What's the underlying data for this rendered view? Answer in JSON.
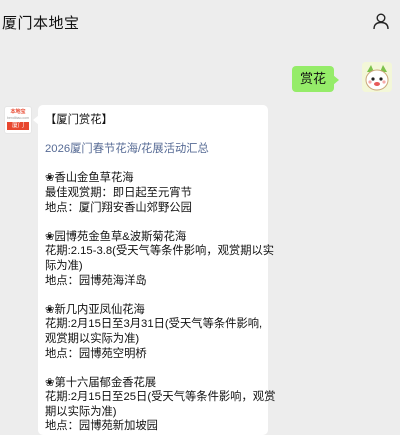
{
  "header": {
    "title": "厦门本地宝",
    "user_icon": "person-icon"
  },
  "chat": {
    "user_message": "赏花",
    "bot_avatar": {
      "line1": "本地宝",
      "line2": "bendibao.com",
      "badge": "厦门"
    },
    "bot_lines": [
      {
        "text": "【厦门赏花】",
        "link": false
      },
      {
        "text": "",
        "link": false
      },
      {
        "text": "2026厦门春节花海/花展活动汇总",
        "link": true
      },
      {
        "text": "",
        "link": false
      },
      {
        "text": "❀香山金鱼草花海",
        "link": false
      },
      {
        "text": "最佳观赏期：即日起至元宵节",
        "link": false
      },
      {
        "text": "地点：厦门翔安香山郊野公园",
        "link": false
      },
      {
        "text": "",
        "link": false
      },
      {
        "text": "❀园博苑金鱼草&波斯菊花海",
        "link": false
      },
      {
        "text": "花期:2.15-3.8(受天气等条件影响，观赏期以实",
        "link": false
      },
      {
        "text": "际为准)",
        "link": false
      },
      {
        "text": "地点：园博苑海洋岛",
        "link": false
      },
      {
        "text": "",
        "link": false
      },
      {
        "text": "❀新几内亚凤仙花海",
        "link": false
      },
      {
        "text": "花期:2月15日至3月31日(受天气等条件影响,",
        "link": false
      },
      {
        "text": "观赏期以实际为准)",
        "link": false
      },
      {
        "text": "地点：园博苑空明桥",
        "link": false
      },
      {
        "text": "",
        "link": false
      },
      {
        "text": "❀第十六届郁金香花展",
        "link": false
      },
      {
        "text": "花期:2月15日至25日(受天气等条件影响，观赏",
        "link": false
      },
      {
        "text": "期以实际为准)",
        "link": false
      },
      {
        "text": "地点：园博苑新加坡园",
        "link": false
      }
    ]
  },
  "colors": {
    "background": "#ededed",
    "user_bubble": "#95ec69",
    "link": "#576b95"
  }
}
